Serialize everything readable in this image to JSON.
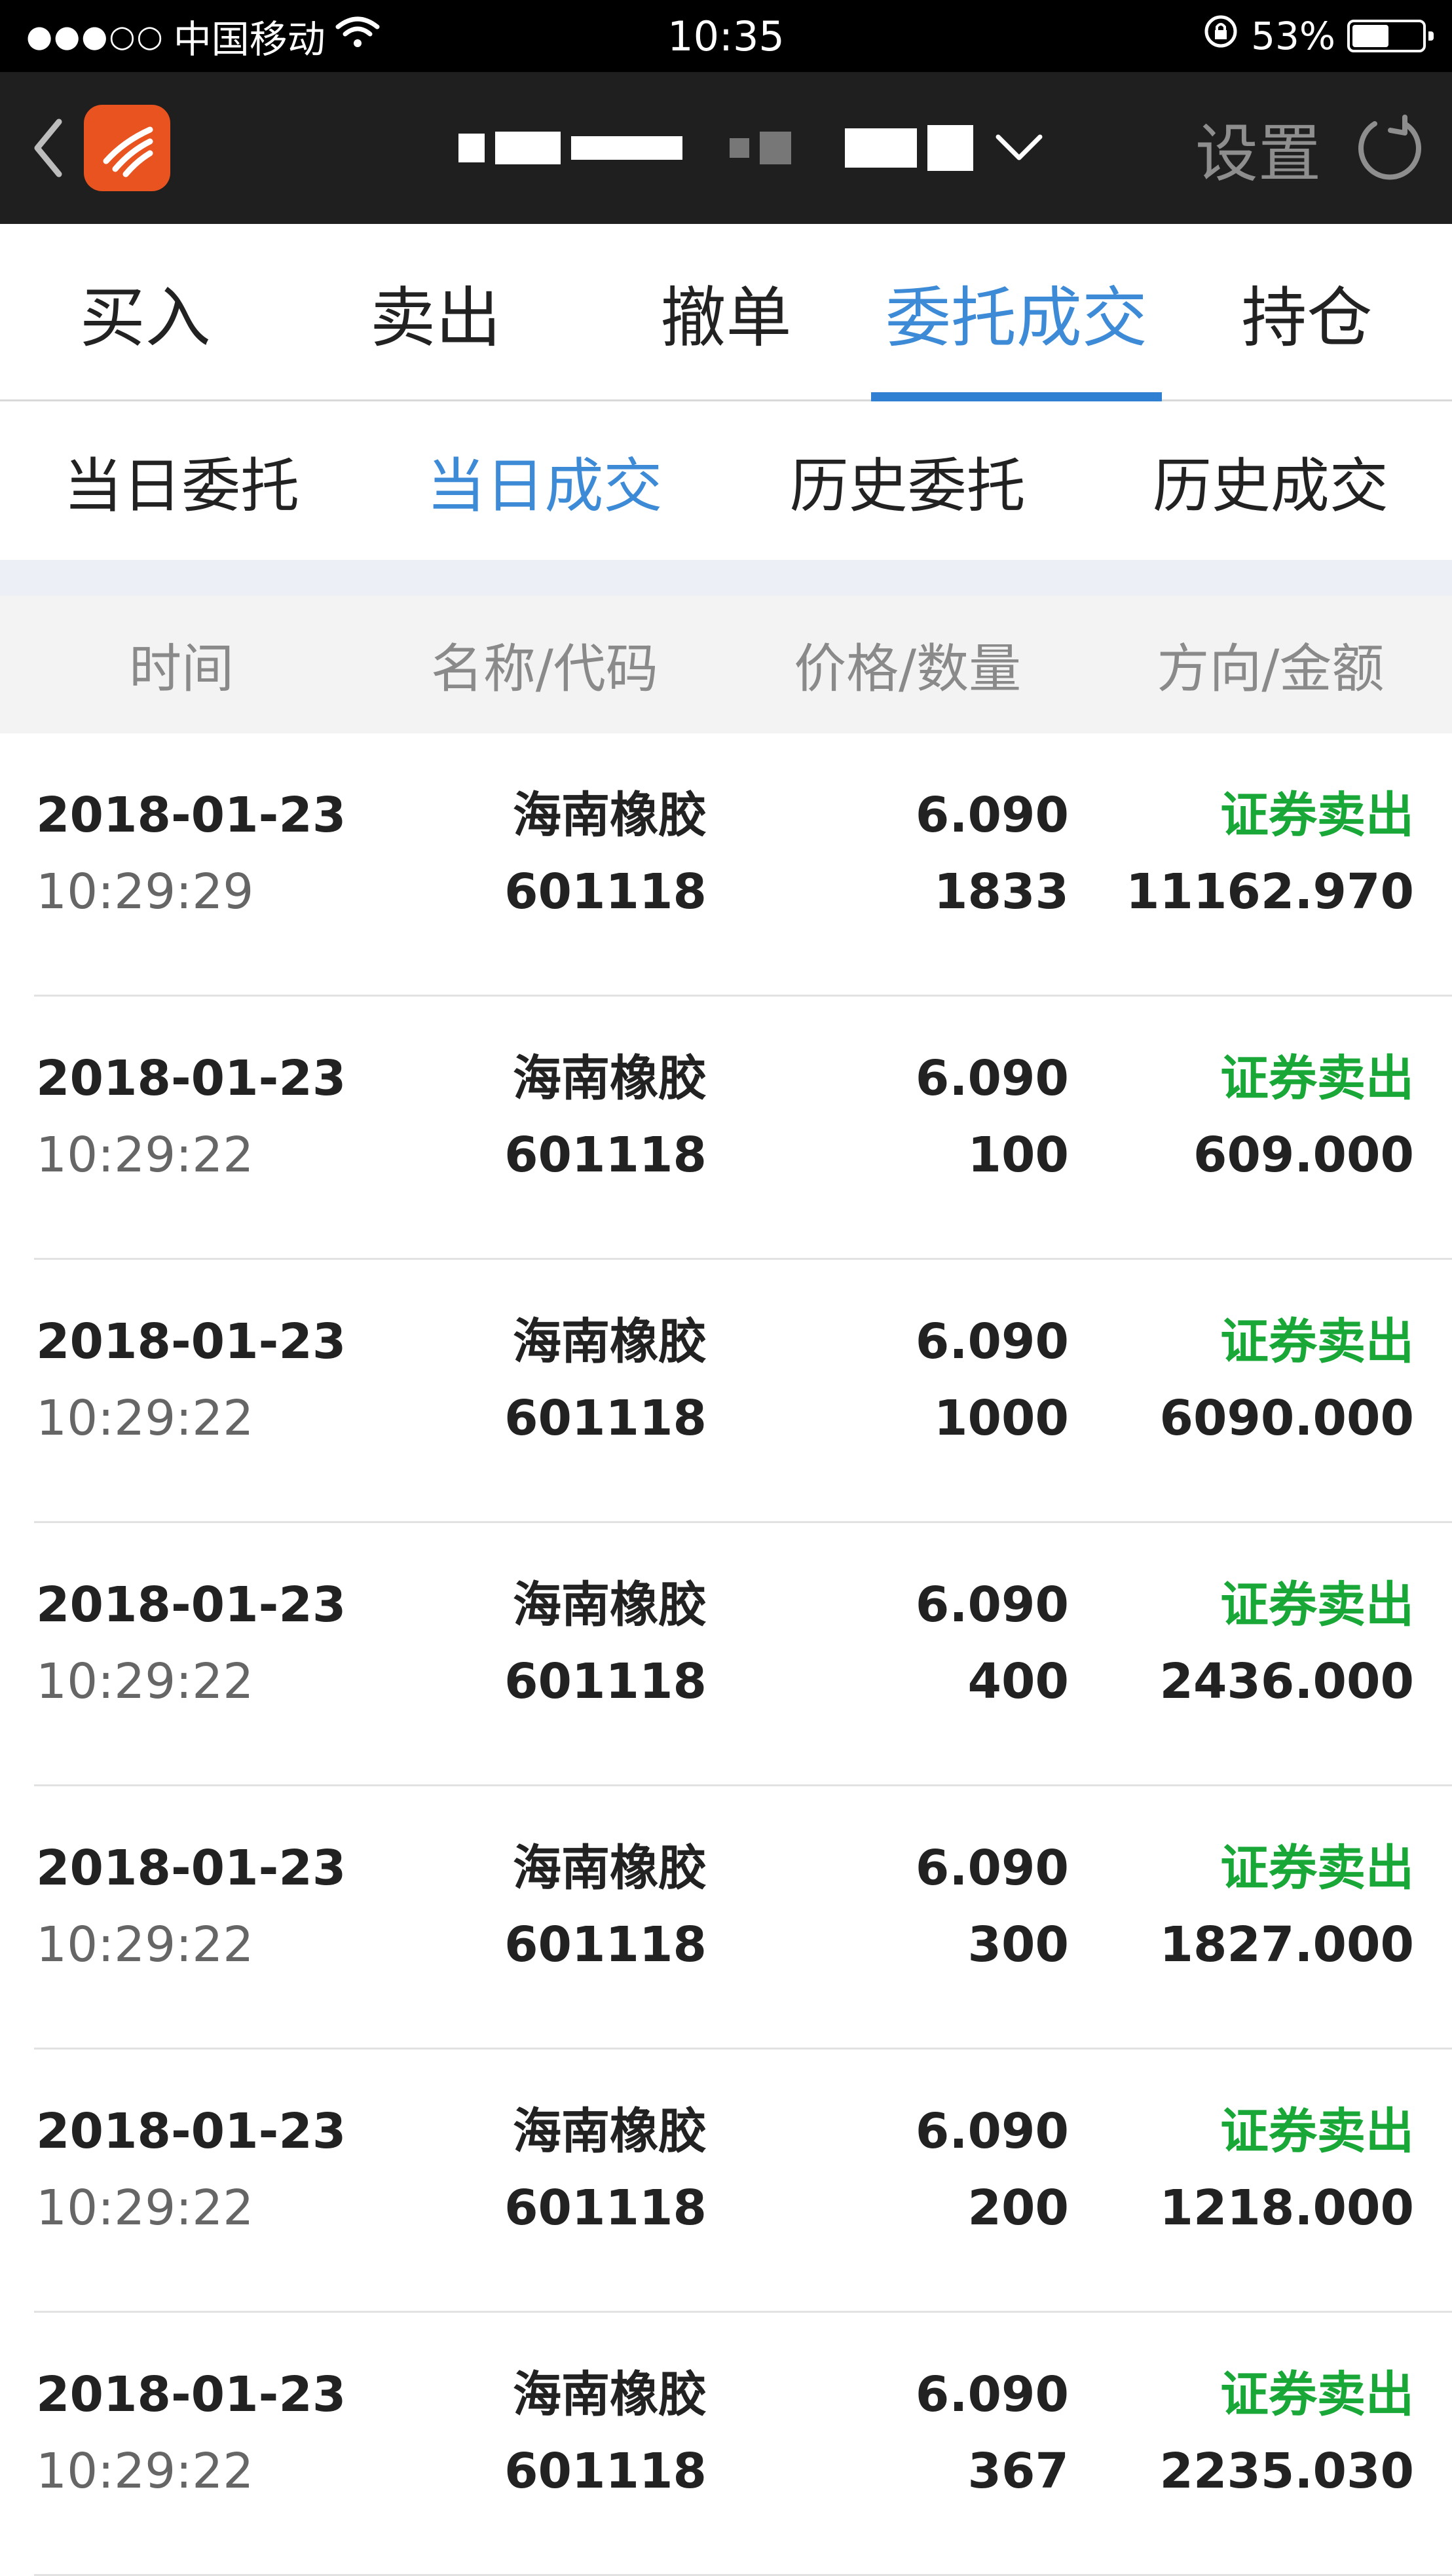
{
  "status_bar": {
    "signal": "●●●○○",
    "carrier": "中国移动",
    "time": "10:35",
    "battery": "53%",
    "battery_level": 0.53
  },
  "header": {
    "settings_label": "设置"
  },
  "main_tabs": [
    {
      "label": "买入"
    },
    {
      "label": "卖出"
    },
    {
      "label": "撤单"
    },
    {
      "label": "委托成交",
      "active": true
    },
    {
      "label": "持仓"
    }
  ],
  "sub_tabs": [
    {
      "label": "当日委托"
    },
    {
      "label": "当日成交",
      "active": true
    },
    {
      "label": "历史委托"
    },
    {
      "label": "历史成交"
    }
  ],
  "table": {
    "columns": [
      "时间",
      "名称/代码",
      "价格/数量",
      "方向/金额"
    ],
    "rows": [
      {
        "date": "2018-01-23",
        "time": "10:29:29",
        "name": "海南橡胶",
        "code": "601118",
        "price": "6.090",
        "qty": "1833",
        "direction": "证券卖出",
        "amount": "11162.970"
      },
      {
        "date": "2018-01-23",
        "time": "10:29:22",
        "name": "海南橡胶",
        "code": "601118",
        "price": "6.090",
        "qty": "100",
        "direction": "证券卖出",
        "amount": "609.000"
      },
      {
        "date": "2018-01-23",
        "time": "10:29:22",
        "name": "海南橡胶",
        "code": "601118",
        "price": "6.090",
        "qty": "1000",
        "direction": "证券卖出",
        "amount": "6090.000"
      },
      {
        "date": "2018-01-23",
        "time": "10:29:22",
        "name": "海南橡胶",
        "code": "601118",
        "price": "6.090",
        "qty": "400",
        "direction": "证券卖出",
        "amount": "2436.000"
      },
      {
        "date": "2018-01-23",
        "time": "10:29:22",
        "name": "海南橡胶",
        "code": "601118",
        "price": "6.090",
        "qty": "300",
        "direction": "证券卖出",
        "amount": "1827.000"
      },
      {
        "date": "2018-01-23",
        "time": "10:29:22",
        "name": "海南橡胶",
        "code": "601118",
        "price": "6.090",
        "qty": "200",
        "direction": "证券卖出",
        "amount": "1218.000"
      },
      {
        "date": "2018-01-23",
        "time": "10:29:22",
        "name": "海南橡胶",
        "code": "601118",
        "price": "6.090",
        "qty": "367",
        "direction": "证券卖出",
        "amount": "2235.030"
      }
    ]
  },
  "colors": {
    "accent_blue": "#3d8ad6",
    "sell_green": "#19a838",
    "nav_bg": "#1f1f1f",
    "logo_orange": "#e8531f"
  }
}
